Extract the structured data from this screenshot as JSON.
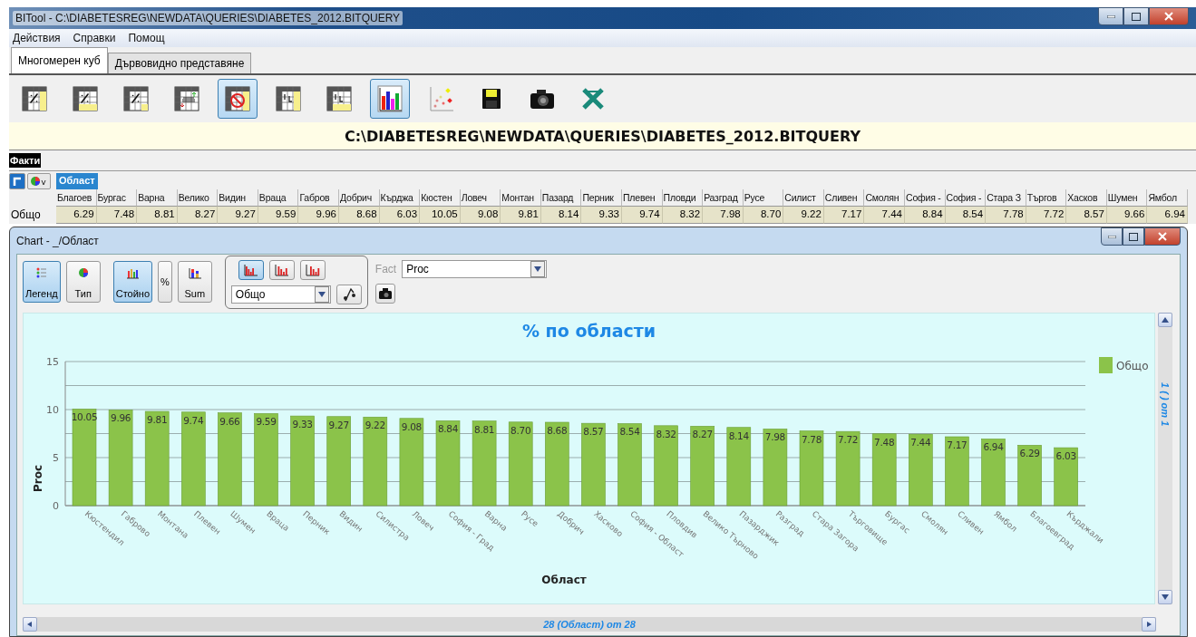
{
  "window": {
    "title": "BITool - C:\\DIABETESREG\\NEWDATA\\QUERIES\\DIABETES_2012.BITQUERY"
  },
  "menu": [
    "Действия",
    "Справки",
    "Помощ"
  ],
  "tabs": [
    {
      "label": "Многомерен куб",
      "selected": true
    },
    {
      "label": "Дървовидно представяне",
      "selected": false
    }
  ],
  "toolbar": [
    {
      "kind": "table-percent",
      "selected": false
    },
    {
      "kind": "table-percent-row",
      "selected": false
    },
    {
      "kind": "table-percent-col",
      "selected": false
    },
    {
      "kind": "table-sort",
      "selected": false
    },
    {
      "kind": "table-hide",
      "selected": true
    },
    {
      "kind": "table-digits",
      "selected": false
    },
    {
      "kind": "table-digits-bars",
      "selected": false
    },
    {
      "kind": "bar-chart",
      "selected": true
    },
    {
      "kind": "scatter",
      "selected": false
    },
    {
      "kind": "save",
      "selected": false
    },
    {
      "kind": "camera",
      "selected": false
    },
    {
      "kind": "excel",
      "selected": false
    }
  ],
  "path_banner": "C:\\DIABETESREG\\NEWDATA\\QUERIES\\DIABETES_2012.BITQUERY",
  "facts_label": "Факти",
  "grid": {
    "dimension": "Област",
    "row_label": "Общо",
    "columns": [
      "Благоев",
      "Бургас",
      "Варна",
      "Велико",
      "Видин",
      "Враца",
      "Габров",
      "Добрич",
      "Кърджа",
      "Кюстен",
      "Ловеч",
      "Монтан",
      "Пазард",
      "Перник",
      "Плевен",
      "Пловди",
      "Разград",
      "Русе",
      "Силист",
      "Сливен",
      "Смолян",
      "София -",
      "София -",
      "Стара З",
      "Търгов",
      "Хасков",
      "Шумен",
      "Ямбол"
    ],
    "values": [
      "6.29",
      "7.48",
      "8.81",
      "8.27",
      "9.27",
      "9.59",
      "9.96",
      "8.68",
      "6.03",
      "10.05",
      "9.08",
      "9.81",
      "8.14",
      "9.33",
      "9.74",
      "8.32",
      "7.98",
      "8.70",
      "9.22",
      "7.17",
      "7.44",
      "8.84",
      "8.54",
      "7.78",
      "7.72",
      "8.57",
      "9.66",
      "6.94"
    ]
  },
  "chart_window": {
    "title": "Chart - _/Област",
    "buttons": [
      {
        "label": "Легенд",
        "kind": "legend",
        "selected": true
      },
      {
        "label": "Тип",
        "kind": "pie",
        "selected": false
      },
      {
        "label": "Стойно",
        "kind": "values",
        "selected": true
      },
      {
        "label": "%",
        "kind": "text",
        "selected": false
      },
      {
        "label": "Sum",
        "kind": "sum",
        "selected": false
      }
    ],
    "chart_types": [
      {
        "kind": "bars-left",
        "selected": true
      },
      {
        "kind": "bars-center",
        "selected": false
      },
      {
        "kind": "bars-right",
        "selected": false
      }
    ],
    "series_select": "Общо",
    "fact_label": "Fact",
    "fact_select": "Proc",
    "chart_data": {
      "type": "bar",
      "title": "% по области",
      "xlabel": "Област",
      "ylabel": "Proc",
      "categories": [
        "Кюстендил",
        "Габрово",
        "Монтана",
        "Плевен",
        "Шумен",
        "Враца",
        "Перник",
        "Видин",
        "Силистра",
        "Ловеч",
        "София - Град",
        "Варна",
        "Русе",
        "Добрич",
        "Хасково",
        "София - Област",
        "Пловдив",
        "Велико Търново",
        "Пазарджик",
        "Разград",
        "Стара Загора",
        "Търговище",
        "Бургас",
        "Смолян",
        "Сливен",
        "Ямбол",
        "Благоевград",
        "Кърджали"
      ],
      "series": [
        {
          "name": "Общо",
          "color": "#8bc34a",
          "values": [
            10.05,
            9.96,
            9.81,
            9.74,
            9.66,
            9.59,
            9.33,
            9.27,
            9.22,
            9.08,
            8.84,
            8.81,
            8.7,
            8.68,
            8.57,
            8.54,
            8.32,
            8.27,
            8.14,
            7.98,
            7.78,
            7.72,
            7.48,
            7.44,
            7.17,
            6.94,
            6.29,
            6.03
          ]
        }
      ],
      "ylim": [
        0,
        15
      ],
      "yticks": [
        0,
        5,
        10,
        15
      ],
      "value_labels": [
        "10.05",
        "9.96",
        "9.81",
        "9.74",
        "9.66",
        "9.59",
        "9.33",
        "9.27",
        "9.22",
        "9.08",
        "8.84",
        "8.81",
        "8.70",
        "8.68",
        "8.57",
        "8.54",
        "8.32",
        "8.27",
        "8.14",
        "7.98",
        "7.78",
        "7.72",
        "7.48",
        "7.44",
        "7.17",
        "6.94",
        "6.29",
        "6.03"
      ]
    },
    "vscroll_text": "1 ( ) от 1",
    "hscroll_text": "28 (Област) от 28"
  }
}
